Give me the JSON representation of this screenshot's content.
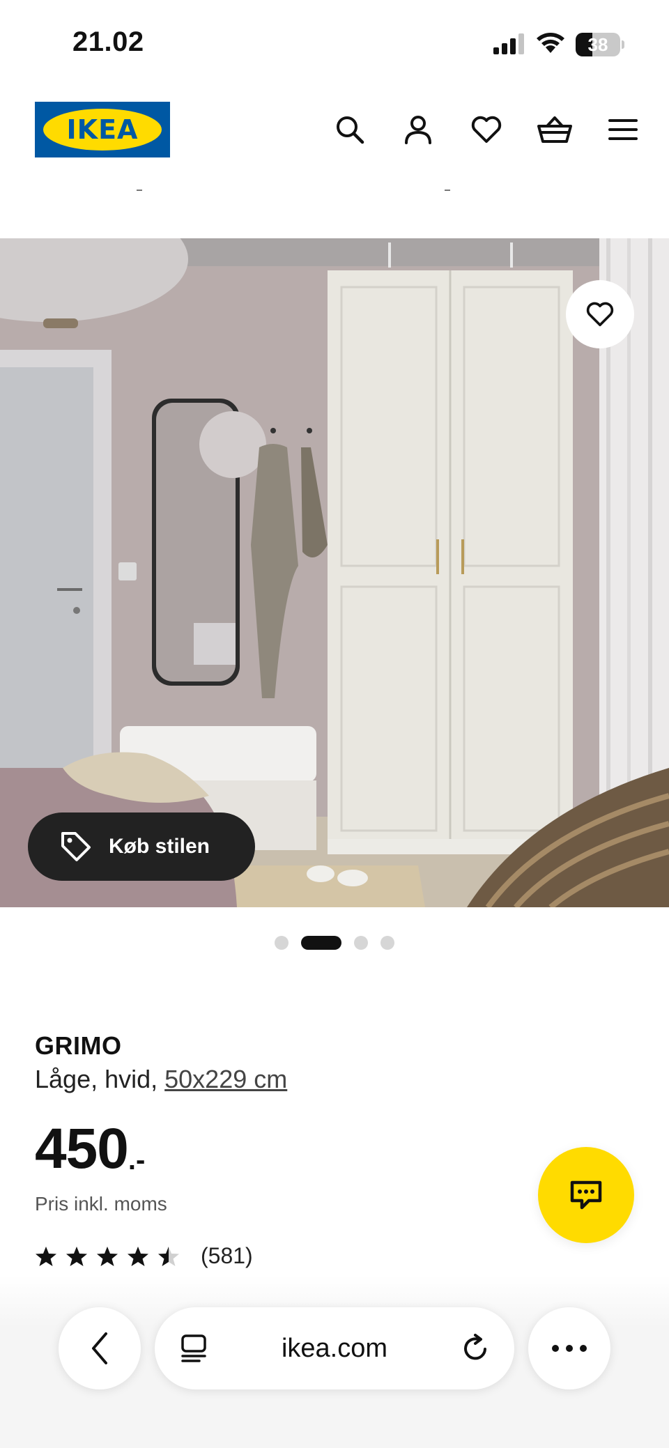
{
  "status_bar": {
    "time": "21.02",
    "battery": "38",
    "battery_percent": 38,
    "icons": [
      "cellular-signal-icon",
      "wifi-icon",
      "battery-icon"
    ]
  },
  "header": {
    "logo_text": "IKEA",
    "icons": [
      "search-icon",
      "account-icon",
      "heart-icon",
      "basket-icon",
      "menu-icon"
    ],
    "brand_colors": {
      "blue": "#0058a3",
      "yellow": "#ffdb00"
    }
  },
  "gallery": {
    "buy_style_label": "Køb stilen",
    "favorite_icon": "heart-icon",
    "dots_count": 4,
    "active_dot_index": 1
  },
  "product": {
    "name": "GRIMO",
    "description": "Låge, hvid, ",
    "size_link": "50x229 cm",
    "price": "450",
    "price_suffix": ".-",
    "price_note": "Pris inkl. moms",
    "rating_value": 4.5,
    "rating_count": "(581)"
  },
  "chat_button": {
    "icon": "chat-icon",
    "color": "#ffdb00"
  },
  "browser_bar": {
    "url": "ikea.com",
    "icons": [
      "back-icon",
      "tabs-icon",
      "reload-icon",
      "more-icon"
    ]
  }
}
